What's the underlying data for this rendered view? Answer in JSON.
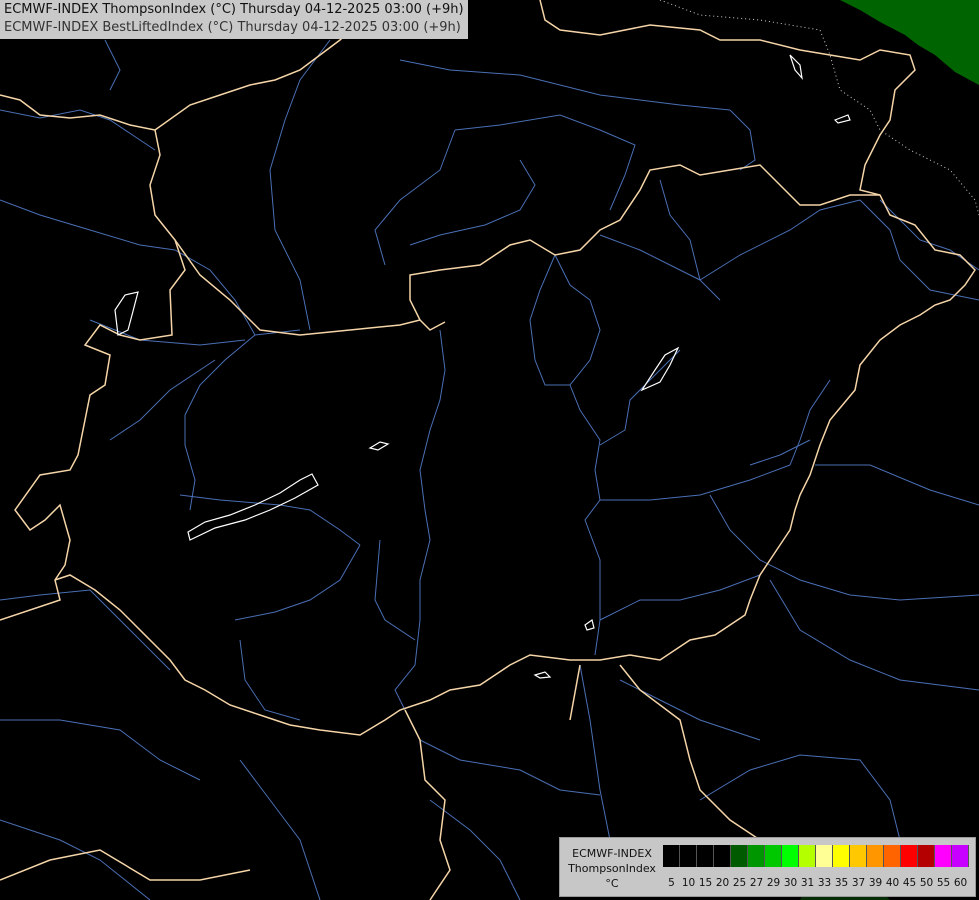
{
  "header": {
    "line1": "ECMWF-INDEX ThompsonIndex (°C) Thursday 04-12-2025 03:00 (+9h)",
    "line2": "ECMWF-INDEX BestLiftedIndex (°C) Thursday 04-12-2025 03:00 (+9h)"
  },
  "legend": {
    "model": "ECMWF-INDEX",
    "parameter": "ThompsonIndex",
    "unit": "°C",
    "colors": [
      "#000000",
      "#000000",
      "#000000",
      "#000000",
      "#005a00",
      "#009600",
      "#00c800",
      "#00ff00",
      "#b4ff00",
      "#ffff96",
      "#ffff00",
      "#ffc800",
      "#ff9600",
      "#ff6400",
      "#ff0000",
      "#b40000",
      "#ff00ff",
      "#c800ff",
      "#9600ff",
      "#6400ff",
      "#0000ff"
    ],
    "ticks": [
      "5",
      "10",
      "15",
      "20",
      "25",
      "27",
      "29",
      "30",
      "31",
      "33",
      "35",
      "37",
      "39",
      "40",
      "45",
      "50",
      "55",
      "60"
    ]
  },
  "style": {
    "background": "#000000",
    "border_color": "#f5d5a8",
    "river_color": "#4a6fb5",
    "lake_color": "#ffffff",
    "green_area": "#006400"
  }
}
